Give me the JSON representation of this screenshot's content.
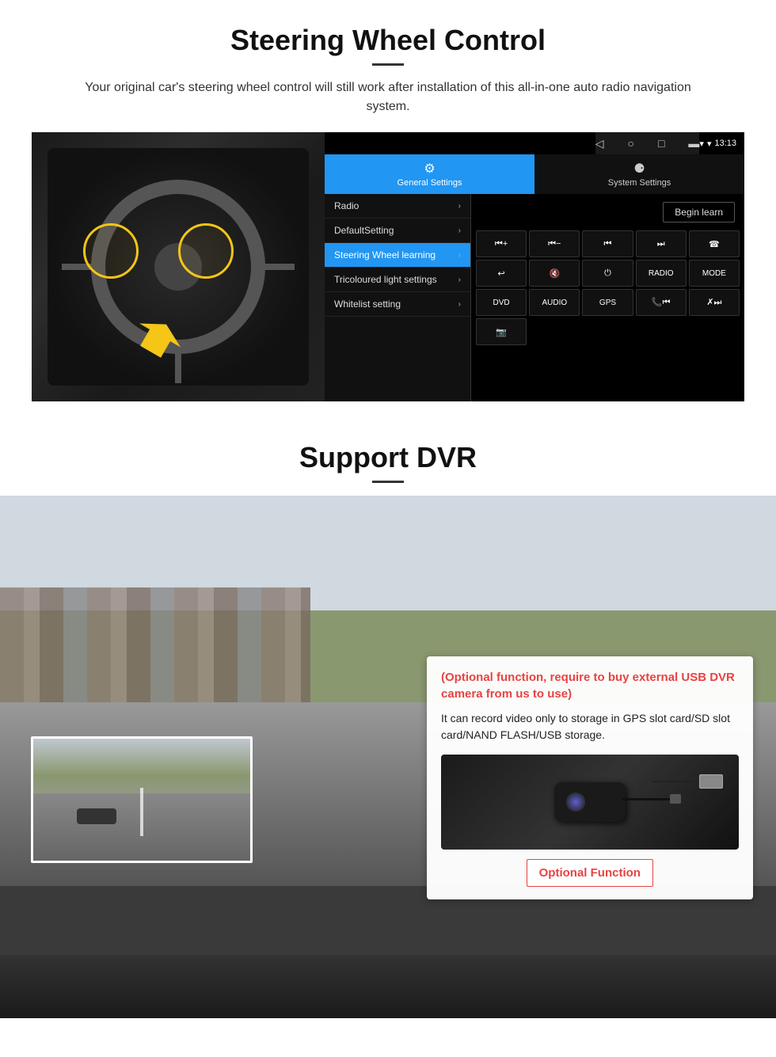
{
  "page": {
    "steering_section": {
      "title": "Steering Wheel Control",
      "subtitle": "Your original car's steering wheel control will still work after installation of this all-in-one auto radio navigation system."
    },
    "android_ui": {
      "status_time": "13:13",
      "tabs": [
        {
          "label": "General Settings",
          "active": true
        },
        {
          "label": "System Settings",
          "active": false
        }
      ],
      "menu_items": [
        {
          "label": "Radio",
          "active": false
        },
        {
          "label": "DefaultSetting",
          "active": false
        },
        {
          "label": "Steering Wheel learning",
          "active": true
        },
        {
          "label": "Tricoloured light settings",
          "active": false
        },
        {
          "label": "Whitelist setting",
          "active": false
        }
      ],
      "begin_learn_btn": "Begin learn",
      "control_buttons_row1": [
        "⏮+",
        "⏮-",
        "⏮⏮",
        "⏭⏭",
        "☎"
      ],
      "control_buttons_row2": [
        "↩",
        "🔇",
        "⏻",
        "RADIO",
        "MODE"
      ],
      "control_buttons_row3": [
        "DVD",
        "AUDIO",
        "GPS",
        "📞⏮",
        "✗⏭"
      ],
      "control_buttons_row4": [
        "📷"
      ]
    },
    "dvr_section": {
      "title": "Support DVR",
      "optional_text": "(Optional function, require to buy external USB DVR camera from us to use)",
      "body_text": "It can record video only to storage in GPS slot card/SD slot card/NAND FLASH/USB storage.",
      "optional_btn_label": "Optional Function"
    }
  }
}
